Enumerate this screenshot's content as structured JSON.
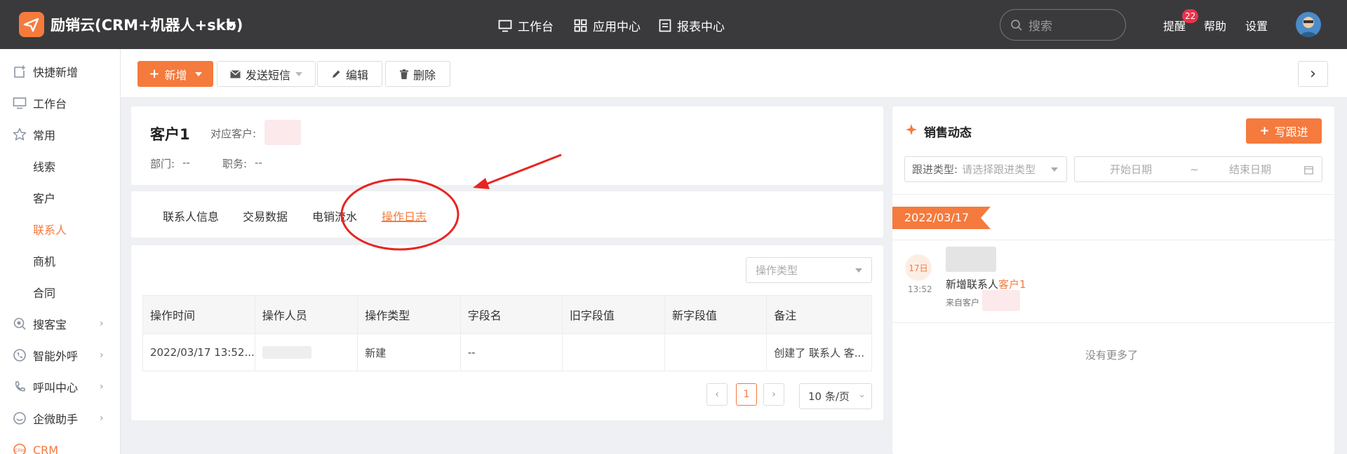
{
  "topbar": {
    "app_title": "励销云(CRM+机器人+skb)",
    "nav": [
      {
        "label": "工作台",
        "icon": "monitor-icon"
      },
      {
        "label": "应用中心",
        "icon": "grid-icon"
      },
      {
        "label": "报表中心",
        "icon": "report-icon"
      }
    ],
    "search_placeholder": "搜索",
    "reminder": "提醒",
    "reminder_count": "22",
    "help": "帮助",
    "settings": "设置"
  },
  "sidebar": {
    "items": [
      {
        "label": "快捷新增",
        "icon": "add-note-icon"
      },
      {
        "label": "工作台",
        "icon": "monitor-icon"
      },
      {
        "label": "常用",
        "icon": "star-icon"
      },
      {
        "label": "线索"
      },
      {
        "label": "客户"
      },
      {
        "label": "联系人",
        "active": true
      },
      {
        "label": "商机"
      },
      {
        "label": "合同"
      },
      {
        "label": "搜客宝",
        "icon": "search-treasure-icon",
        "expandable": true
      },
      {
        "label": "智能外呼",
        "icon": "phone-icon",
        "expandable": true
      },
      {
        "label": "呼叫中心",
        "icon": "call-center-icon",
        "expandable": true
      },
      {
        "label": "企微助手",
        "icon": "wecom-icon",
        "expandable": true
      },
      {
        "label": "CRM",
        "icon": "crm-icon"
      }
    ]
  },
  "toolbar": {
    "new_label": "新增",
    "sms_label": "发送短信",
    "edit_label": "编辑",
    "delete_label": "删除"
  },
  "contact": {
    "name": "客户1",
    "customer_label": "对应客户:",
    "dept_label": "部门:",
    "dept_value": "--",
    "position_label": "职务:",
    "position_value": "--"
  },
  "tabs": [
    {
      "label": "联系人信息"
    },
    {
      "label": "交易数据"
    },
    {
      "label": "电销流水"
    },
    {
      "label": "操作日志",
      "active": true
    }
  ],
  "log": {
    "filter_placeholder": "操作类型",
    "columns": [
      "操作时间",
      "操作人员",
      "操作类型",
      "字段名",
      "旧字段值",
      "新字段值",
      "备注"
    ],
    "rows": [
      {
        "time": "2022/03/17 13:52...",
        "type": "新建",
        "field": "--",
        "old": "",
        "new": "",
        "remark": "创建了 联系人 客..."
      }
    ],
    "page": "1",
    "page_size": "10 条/页"
  },
  "sales": {
    "title": "销售动态",
    "write_followup": "写跟进",
    "followup_type_label": "跟进类型:",
    "followup_type_placeholder": "请选择跟进类型",
    "start_date": "开始日期",
    "date_sep": "~",
    "end_date": "结束日期",
    "date_tag": "2022/03/17",
    "day": "17日",
    "time": "13:52",
    "activity_prefix": "新增联系人",
    "activity_link": "客户1",
    "source": "来自客户",
    "no_more": "没有更多了"
  },
  "colors": {
    "accent": "#f57a3d",
    "topbar": "#3a3a3c",
    "annotation": "#e8251f"
  }
}
